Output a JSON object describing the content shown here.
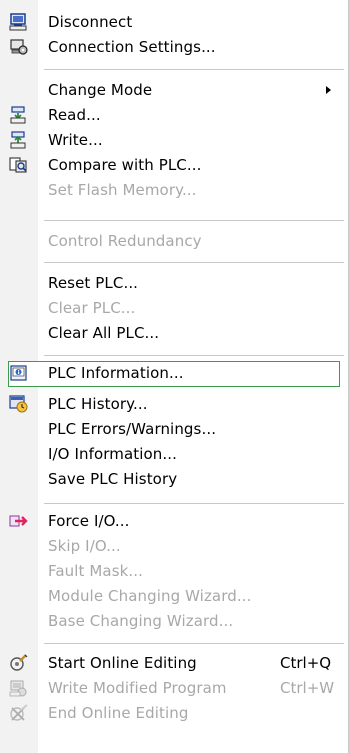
{
  "menu": {
    "items": [
      {
        "label": "Disconnect",
        "icon": "disconnect-icon"
      },
      {
        "label": "Connection Settings...",
        "icon": "connection-settings-icon"
      },
      {
        "label": "Change Mode"
      },
      {
        "label": "Read...",
        "icon": "read-icon"
      },
      {
        "label": "Write...",
        "icon": "write-icon"
      },
      {
        "label": "Compare with PLC...",
        "icon": "compare-icon"
      },
      {
        "label": "Set Flash Memory..."
      },
      {
        "label": "Control Redundancy"
      },
      {
        "label": "Reset PLC..."
      },
      {
        "label": "Clear PLC..."
      },
      {
        "label": "Clear All PLC..."
      },
      {
        "label": "PLC Information...",
        "icon": "plc-information-icon"
      },
      {
        "label": "PLC History...",
        "icon": "plc-history-icon"
      },
      {
        "label": "PLC Errors/Warnings..."
      },
      {
        "label": "I/O Information..."
      },
      {
        "label": "Save PLC History"
      },
      {
        "label": "Force I/O...",
        "icon": "force-io-icon"
      },
      {
        "label": "Skip I/O..."
      },
      {
        "label": "Fault Mask..."
      },
      {
        "label": "Module Changing Wizard..."
      },
      {
        "label": "Base Changing Wizard..."
      },
      {
        "label": "Start Online Editing",
        "shortcut": "Ctrl+Q",
        "icon": "start-online-editing-icon"
      },
      {
        "label": "Write Modified Program",
        "shortcut": "Ctrl+W",
        "icon": "write-modified-icon"
      },
      {
        "label": "End Online Editing",
        "icon": "end-online-editing-icon"
      }
    ]
  },
  "colors": {
    "selection_border": "#3c9a4a",
    "disabled_text": "#a8a8a8",
    "icon_column": "#f2f2f2"
  }
}
